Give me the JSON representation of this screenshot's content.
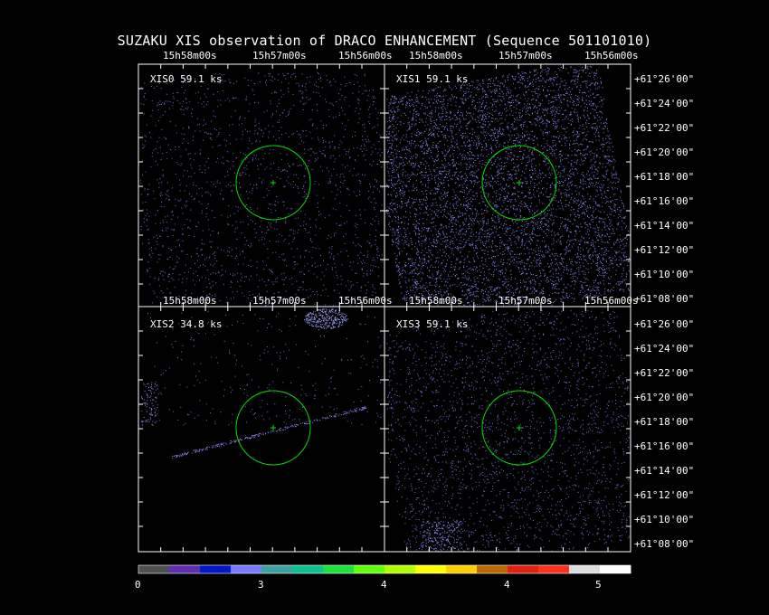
{
  "title": "SUZAKU XIS observation of DRACO ENHANCEMENT  (Sequence 501101010)",
  "panels": [
    {
      "label": "XIS0 59.1 ks"
    },
    {
      "label": "XIS1 59.1 ks"
    },
    {
      "label": "XIS2 34.8 ks"
    },
    {
      "label": "XIS3 59.1 ks"
    }
  ],
  "ra_ticks_left": [
    "15h58m00s",
    "15h57m00s",
    "15h56m00s"
  ],
  "ra_ticks_right": [
    "15h58m00s",
    "15h57m00s",
    "15h56m00s"
  ],
  "dec_ticks": [
    "+61°26'00\"",
    "+61°24'00\"",
    "+61°22'00\"",
    "+61°20'00\"",
    "+61°18'00\"",
    "+61°16'00\"",
    "+61°14'00\"",
    "+61°12'00\"",
    "+61°10'00\"",
    "+61°08'00\""
  ],
  "colorbar": {
    "labels": [
      "0",
      "3",
      "4",
      "4",
      "5"
    ],
    "colors": [
      "#505050",
      "#6030b0",
      "#0018c8",
      "#7a7aff",
      "#40a0a0",
      "#10c090",
      "#20e040",
      "#60ff10",
      "#b0ff00",
      "#ffff00",
      "#ffd000",
      "#b86a00",
      "#e02010",
      "#ff3020",
      "#dddddd",
      "#ffffff"
    ]
  },
  "colors": {
    "circle": "#00dd00",
    "event": "#7070e0",
    "frame": "#ffffff"
  }
}
